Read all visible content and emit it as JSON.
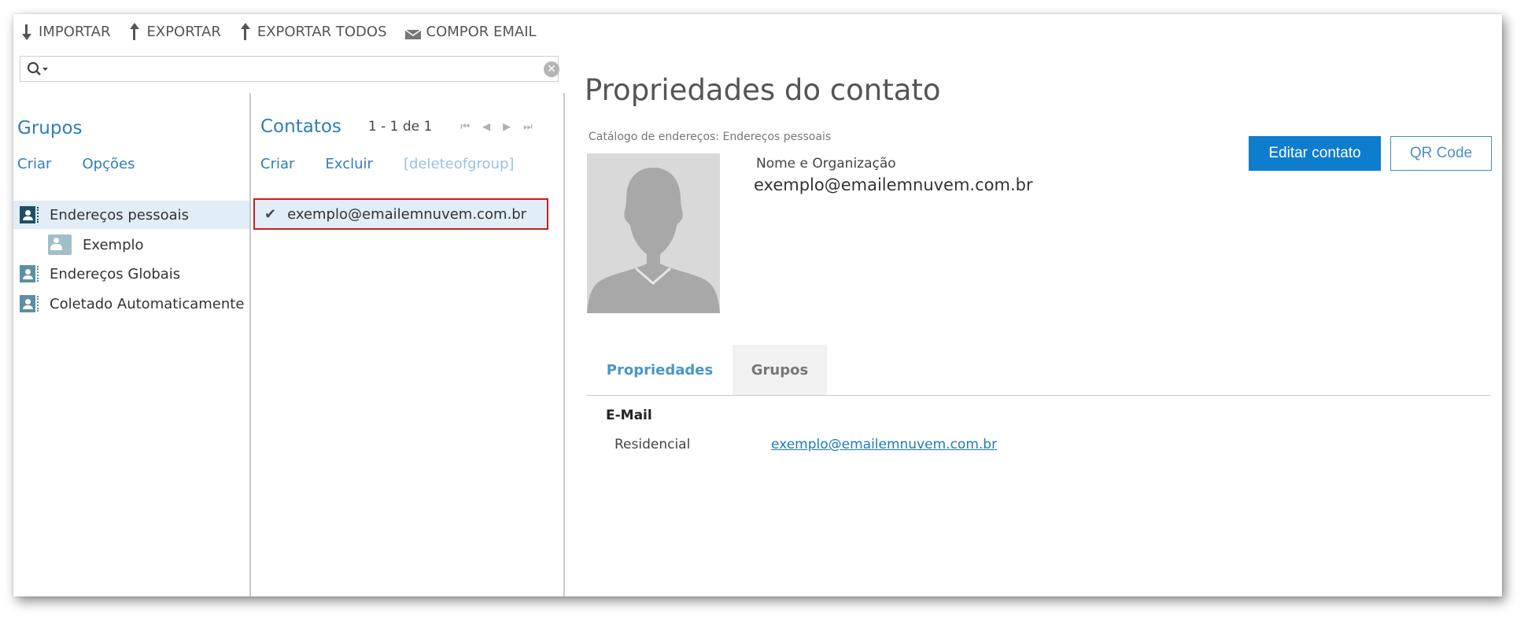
{
  "toolbar": {
    "import": "IMPORTAR",
    "export": "EXPORTAR",
    "export_all": "EXPORTAR TODOS",
    "compose": "COMPOR EMAIL"
  },
  "search": {
    "placeholder": "",
    "value": ""
  },
  "groups": {
    "title": "Grupos",
    "create": "Criar",
    "options": "Opções",
    "items": [
      {
        "label": "Endereços pessoais",
        "selected": true
      },
      {
        "label": "Exemplo"
      },
      {
        "label": "Endereços Globais"
      },
      {
        "label": "Coletado Automaticamente"
      }
    ]
  },
  "contacts": {
    "title": "Contatos",
    "count": "1 - 1 de 1",
    "create": "Criar",
    "delete": "Excluir",
    "delete_of_group": "[deleteofgroup]",
    "items": [
      {
        "label": "exemplo@emailemnuvem.com.br",
        "selected": true
      }
    ]
  },
  "details": {
    "title": "Propriedades do contato",
    "catalog": "Catálogo de endereços: Endereços pessoais",
    "name_label": "Nome e Organização",
    "name_value": "exemplo@emailemnuvem.com.br",
    "edit_button": "Editar contato",
    "qr_button": "QR Code",
    "tabs": [
      {
        "label": "Propriedades",
        "active": true
      },
      {
        "label": "Grupos"
      }
    ],
    "section_title": "E-Mail",
    "field_label": "Residencial",
    "field_value": "exemplo@emailemnuvem.com.br"
  },
  "colors": {
    "accent": "#2f7fb8",
    "button_primary": "#0e7dce",
    "selected_bg": "#e1edf7",
    "highlight_border": "#c81f1f"
  }
}
